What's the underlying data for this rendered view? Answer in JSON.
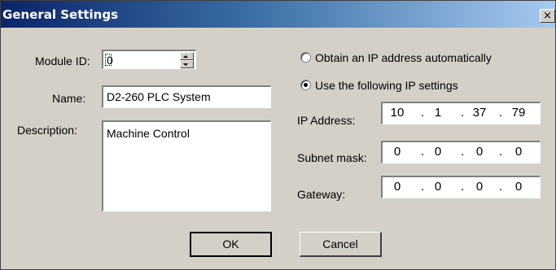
{
  "window": {
    "title": "General Settings",
    "close_glyph": "×"
  },
  "form": {
    "module_id_label": "Module ID:",
    "module_id_value": "0",
    "name_label": "Name:",
    "name_value": "D2-260 PLC System",
    "description_label": "Description:",
    "description_value": "Machine Control"
  },
  "network": {
    "option_auto": "Obtain an IP address automatically",
    "option_manual": "Use the following IP settings",
    "selected": "manual",
    "ip_label": "IP Address:",
    "ip": [
      "10",
      "1",
      "37",
      "79"
    ],
    "subnet_label": "Subnet mask:",
    "subnet": [
      "0",
      "0",
      "0",
      "0"
    ],
    "gateway_label": "Gateway:",
    "gateway": [
      "0",
      "0",
      "0",
      "0"
    ],
    "separator": "."
  },
  "buttons": {
    "ok": "OK",
    "cancel": "Cancel"
  },
  "colors": {
    "face": "#d4d0c8",
    "title_start": "#0a246a",
    "title_end": "#a6caf0"
  }
}
